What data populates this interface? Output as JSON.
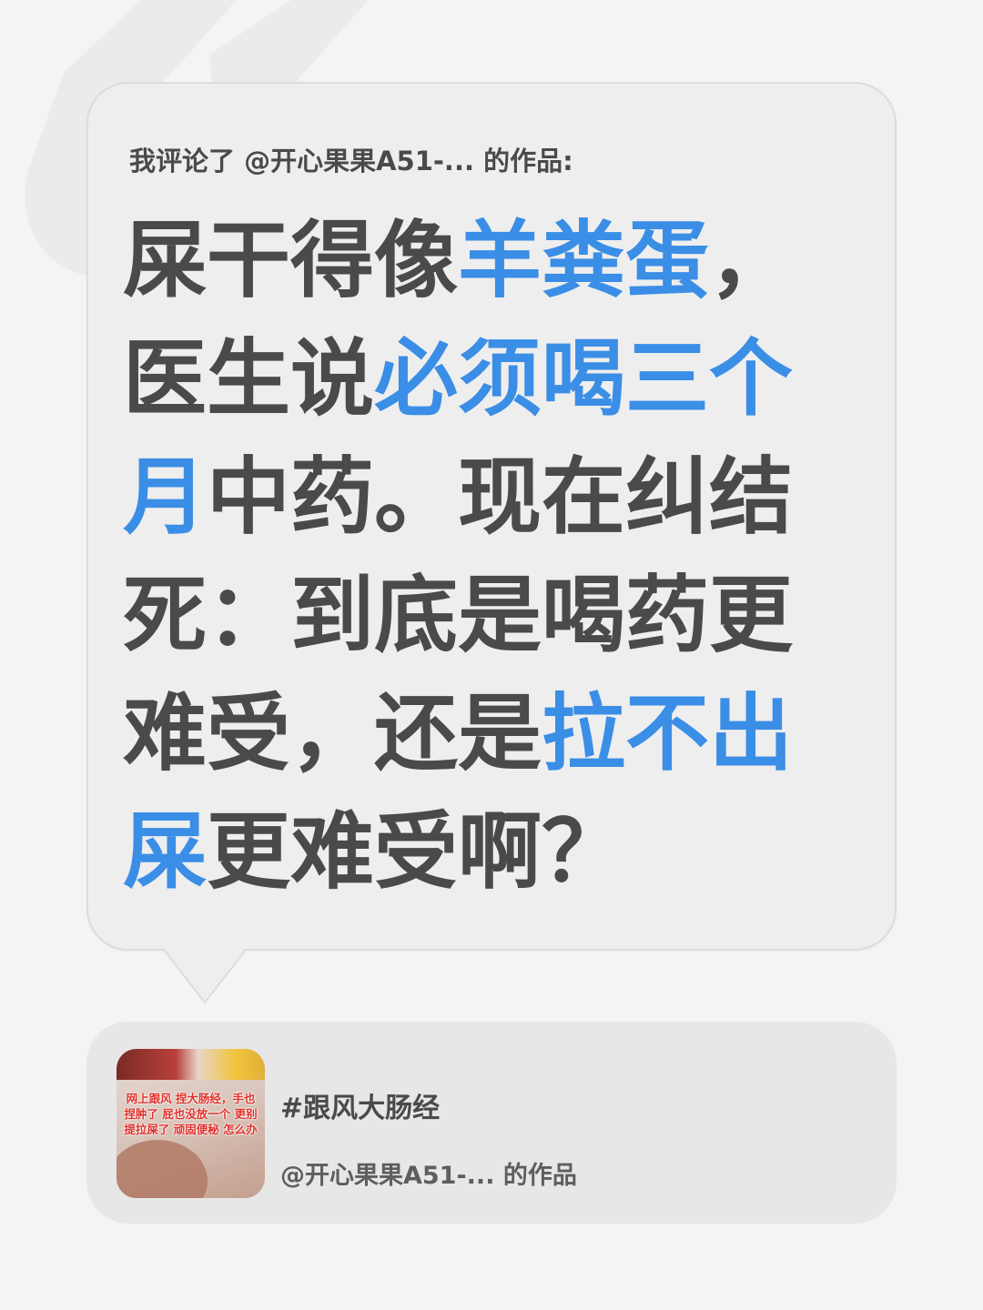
{
  "comment": {
    "header": "我评论了 @开心果果A51-... 的作品:",
    "body_segments": [
      {
        "text": "屎干得像",
        "highlight": false
      },
      {
        "text": "羊粪蛋",
        "highlight": true
      },
      {
        "text": "，医生说",
        "highlight": false
      },
      {
        "text": "必须喝三个月",
        "highlight": true
      },
      {
        "text": "中药。现在纠结死：到底是喝药更难受，还是",
        "highlight": false
      },
      {
        "text": "拉不出屎",
        "highlight": true
      },
      {
        "text": "更难受啊？",
        "highlight": false
      }
    ]
  },
  "card": {
    "thumbnail_text": "网上跟风 捏大肠经，手也捏肿了 屁也没放一个 更别提拉屎了 顽固便秘 怎么办",
    "title": "#跟风大肠经",
    "subtitle": "@开心果果A51-... 的作品"
  },
  "colors": {
    "background": "#f4f4f4",
    "bubble": "#eeeeee",
    "text": "#4a4a4a",
    "highlight": "#3a8ee6",
    "thumbnail_text": "#e0302a"
  },
  "icons": {
    "quote_mark": "quote-mark-icon",
    "bubble_tail": "speech-bubble-tail"
  }
}
